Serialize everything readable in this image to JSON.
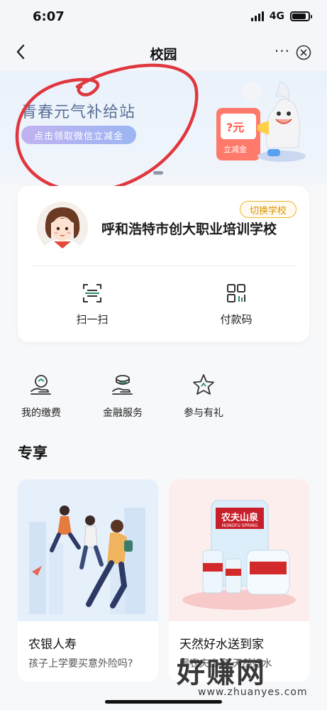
{
  "status_bar": {
    "time": "6:07",
    "network": "4G",
    "battery_level": 0.85
  },
  "nav": {
    "title": "校园",
    "more_label": "···"
  },
  "banner": {
    "title": "青春元气补给站",
    "button_label": "点击领取微信立减金",
    "coupon_label": "立减金",
    "coupon_mark": "?元",
    "slide_count": 2,
    "active_slide": 1
  },
  "school": {
    "switch_label": "切换学校",
    "name": "呼和浩特市创大职业培训学校",
    "actions": [
      {
        "label": "扫一扫",
        "icon": "scan-icon"
      },
      {
        "label": "付款码",
        "icon": "payment-code-icon"
      }
    ]
  },
  "quick_links": [
    {
      "label": "我的缴费",
      "icon": "payment-hand-icon"
    },
    {
      "label": "金融服务",
      "icon": "finance-hand-icon"
    },
    {
      "label": "参与有礼",
      "icon": "star-icon"
    }
  ],
  "section": {
    "title": "专享"
  },
  "promos": [
    {
      "title": "农银人寿",
      "subtitle": "孩子上学要买意外险吗?"
    },
    {
      "title": "天然好水送到家",
      "subtitle": "喝农夫山泉 天然好水",
      "brand_label": "农夫山泉",
      "brand_sub": "NONGFU SPRING"
    }
  ],
  "watermark": {
    "text": "好赚网",
    "url": "www.zhuanyes.com"
  },
  "colors": {
    "accent_green": "#2c8c6a",
    "badge_orange": "#f0b429",
    "annotation_red": "#e0373f"
  }
}
